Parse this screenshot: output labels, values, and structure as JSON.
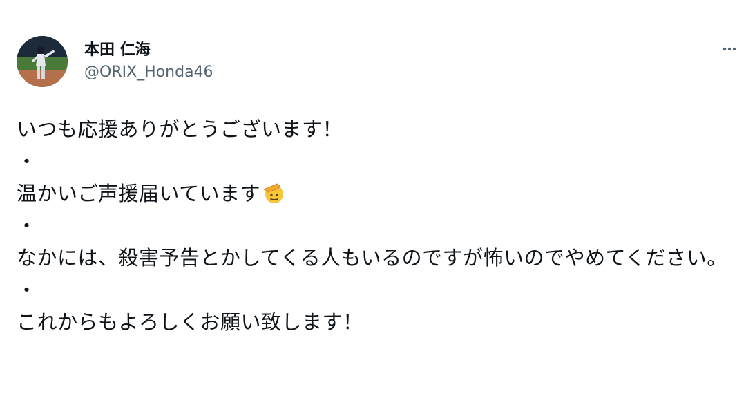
{
  "tweet": {
    "display_name": "本田 仁海",
    "handle": "@ORIX_Honda46",
    "more_icon": "more-horizontal-icon",
    "lines": [
      "いつも応援ありがとうございます！",
      "・",
      "温かいご声援届いています",
      "・",
      "なかには、殺害予告とかしてくる人もいるのですが怖いのでやめてください。",
      "・",
      "これからもよろしくお願い致します！"
    ],
    "emoji": "saluting-face-emoji"
  }
}
